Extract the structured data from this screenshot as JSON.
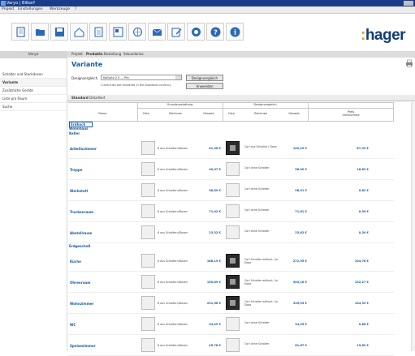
{
  "window": {
    "title": "Varyo | Bilkorf"
  },
  "menu": [
    "Projekt",
    "Einstellungen",
    "Werkzeuge",
    "?"
  ],
  "toolbar": {
    "icons": [
      "new-document-icon",
      "open-folder-icon",
      "save-icon",
      "home-icon",
      "clipboard-icon",
      "layout-icon",
      "network-icon",
      "email-icon",
      "edit-icon",
      "search-globe-icon",
      "help-icon",
      "info-icon"
    ],
    "logo": {
      "main": "hager",
      "prefix": ":"
    }
  },
  "sidebar": {
    "header": "Varyo",
    "items": [
      "Schalter und Steckdosen",
      "Variante",
      "Zusätzliche Geräte",
      "Liste pro Raum",
      "Suche"
    ]
  },
  "tabs": [
    "Projekt",
    "Produkte",
    "Bestellung",
    "Sekundarios"
  ],
  "page": {
    "title": "Variante"
  },
  "form": {
    "label": "Designvergleich",
    "select_value": "Kallysto 2.0 — Pro",
    "button1": "Designvergleich",
    "note": "Currencies are rendered in the standard currency",
    "button2": "Anwenden"
  },
  "subtabs": [
    "Standard",
    "Detailliert"
  ],
  "table": {
    "group1": "Grundausstattung",
    "group2": "Designvergleich",
    "columns": [
      "Raum",
      "Foto",
      "Zeichnen",
      "Gesamt",
      "Foto",
      "Zeichnen",
      "Gesamt",
      "Preis\nUnterschied"
    ],
    "sections": [
      {
        "title": [
          "Erdhoch",
          "Wohnhaus",
          "Keller"
        ],
        "rows": [
          {
            "name": "Arbeitszimmer",
            "desc1": "6 aus Schaltern/Dosen",
            "total1": "81,36 €",
            "desc2": "Corl aus Schalter / Dose",
            "total2": "149,29 €",
            "diff": "67,93 €",
            "dark": true
          },
          {
            "name": "Treppe",
            "desc1": "6 aus Schaltern/Dosen",
            "total1": "40,07 €",
            "desc2": "Corl ohne Schalter",
            "total2": "56,90 €",
            "diff": "16,83 €",
            "dark": false
          },
          {
            "name": "Werkstatt",
            "desc1": "6 aus Schaltern/Dosen",
            "total1": "98,09 €",
            "desc2": "Corl ohne Schalter",
            "total2": "98,91 €",
            "diff": "0,82 €",
            "dark": false
          },
          {
            "name": "Trockenraum",
            "desc1": "6 aus Schaltern/Dosen",
            "total1": "71,02 €",
            "desc2": "Corl ohne Schalter",
            "total2": "71,61 €",
            "diff": "0,59 €",
            "dark": false
          },
          {
            "name": "Abstellraum",
            "desc1": "6 aus Schaltern/Dosen",
            "total1": "23,32 €",
            "desc2": "Corl ohne Schalter",
            "total2": "23,62 €",
            "diff": "0,30 €",
            "dark": false
          }
        ]
      },
      {
        "title": [
          "Erdgeschoß"
        ],
        "rows": [
          {
            "name": "Küche",
            "desc1": "6 aus Schaltern/Dosen",
            "total1": "168,19 €",
            "desc2": "Corl Schalter without / Jo Dose",
            "total2": "272,95 €",
            "diff": "104,76 €",
            "dark": true
          },
          {
            "name": "Ohrenraum",
            "desc1": "6 aus Schaltern/Dosen",
            "total1": "150,89 €",
            "desc2": "Corl Schalter without / Jo Dose",
            "total2": "303,16 €",
            "diff": "152,27 €",
            "dark": true
          },
          {
            "name": "Wohnzimmer",
            "desc1": "6 aus Schaltern/Dosen",
            "total1": "231,56 €",
            "desc2": "Corl Schalter without / Jo Dose",
            "total2": "335,95 €",
            "diff": "104,39 €",
            "dark": true
          },
          {
            "name": "WC",
            "desc1": "6 aus Schaltern/Dosen",
            "total1": "34,29 €",
            "desc2": "Corl ohne Schalter",
            "total2": "34,95 €",
            "diff": "0,66 €",
            "dark": false
          },
          {
            "name": "Speisezimmer",
            "desc1": "6 aus Schaltern/Dosen",
            "total1": "45,78 €",
            "desc2": "Corl ohne Schalter",
            "total2": "61,67 €",
            "diff": "15,89 €",
            "dark": false
          }
        ]
      }
    ]
  }
}
